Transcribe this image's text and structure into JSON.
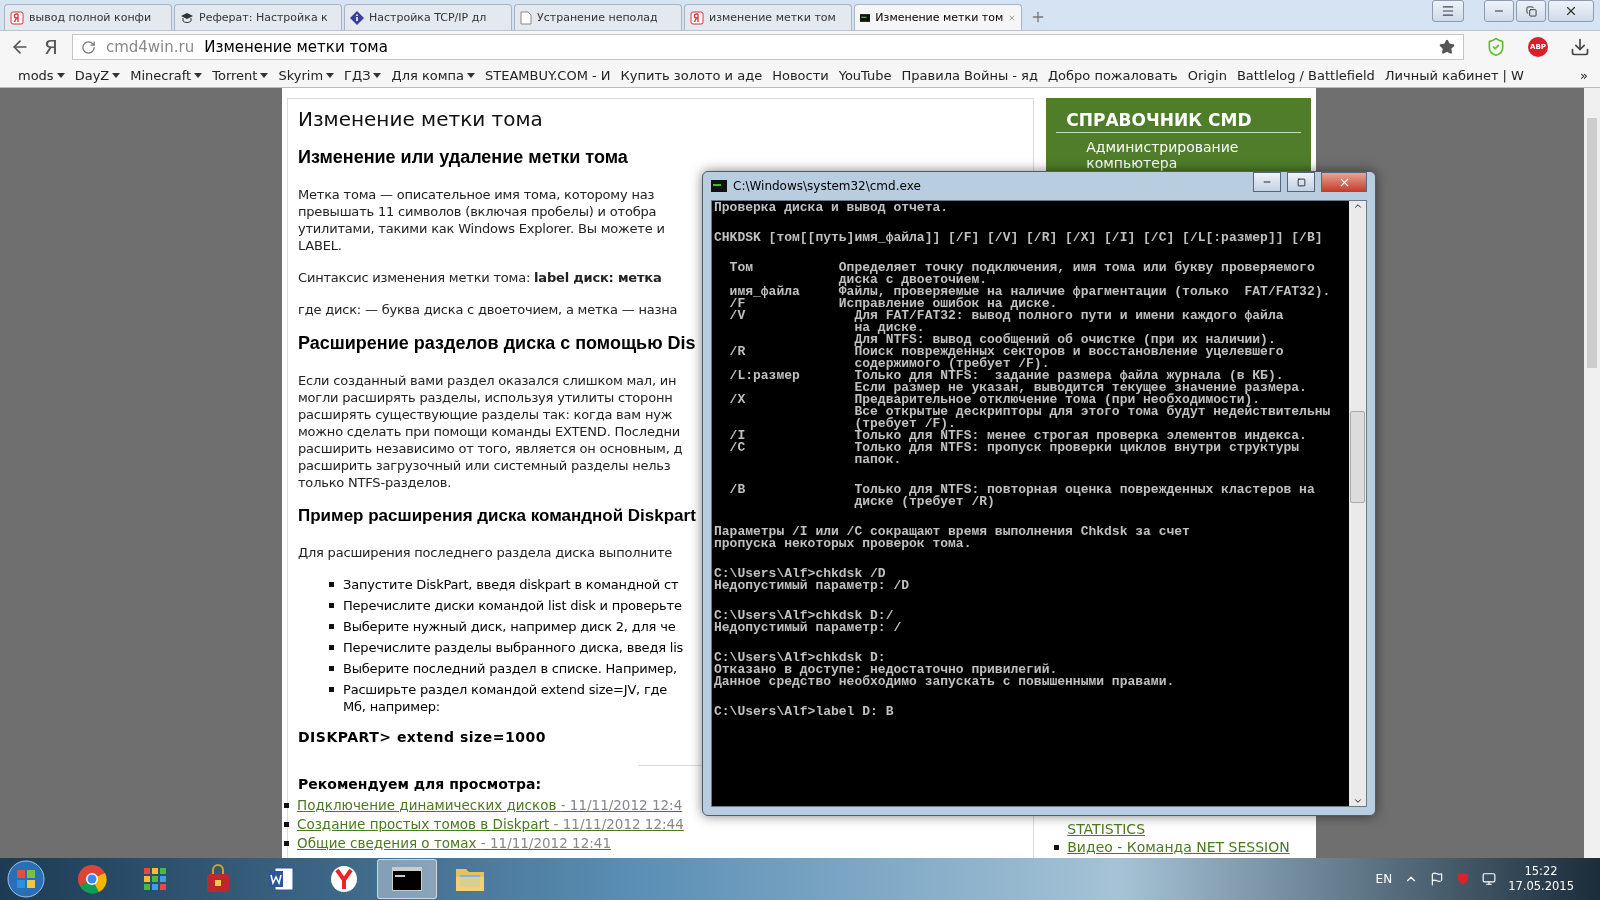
{
  "browser": {
    "tabs": [
      {
        "label": "вывод полной конфи",
        "selected": false
      },
      {
        "label": "Реферат: Настройка к",
        "selected": false
      },
      {
        "label": "Настройка TCP/IP дл",
        "selected": false
      },
      {
        "label": "Устранение неполад",
        "selected": false
      },
      {
        "label": "изменение метки том",
        "selected": false
      },
      {
        "label": "Изменение метки том",
        "selected": true
      }
    ],
    "yandex_button": "Я",
    "address": {
      "domain": "cmd4win.ru",
      "title": "Изменение метки тома"
    },
    "abp_badge": "ABP",
    "bookmarks": [
      {
        "label": "mods",
        "kind": "folder"
      },
      {
        "label": "DayZ",
        "kind": "folder"
      },
      {
        "label": "Minecraft",
        "kind": "folder"
      },
      {
        "label": "Torrent",
        "kind": "folder"
      },
      {
        "label": "Skyrim",
        "kind": "folder"
      },
      {
        "label": "ГДЗ",
        "kind": "folder"
      },
      {
        "label": "Для компа",
        "kind": "folder"
      },
      {
        "label": "STEAMBUY.COM - И",
        "kind": "link"
      },
      {
        "label": "Купить золото и аде",
        "kind": "link"
      },
      {
        "label": "Новости",
        "kind": "link"
      },
      {
        "label": "YouTube",
        "kind": "link"
      },
      {
        "label": "Правила Войны - яд",
        "kind": "link"
      },
      {
        "label": "Добро пожаловать",
        "kind": "link"
      },
      {
        "label": "Origin",
        "kind": "link"
      },
      {
        "label": "Battlelog / Battlefield",
        "kind": "link"
      },
      {
        "label": "Личный кабинет | W",
        "kind": "link"
      }
    ],
    "bookmarks_more": "»"
  },
  "article": {
    "title": "Изменение метки тома",
    "sections": [
      {
        "kind": "h2",
        "text": "Изменение или удаление метки тома"
      },
      {
        "kind": "para",
        "lines": [
          "Метка тома — описательное имя тома, которому наз",
          "превышать 11 символов (включая пробелы) и отобра",
          "утилитами, такими как Windows Explorer. Вы можете и",
          "LABEL."
        ]
      },
      {
        "kind": "para",
        "lines": [
          "Синтаксис изменения метки тома: **label диск: метка**"
        ]
      },
      {
        "kind": "para",
        "lines": [
          "где диск: — буква диска с двоеточием, а метка — назна"
        ]
      },
      {
        "kind": "h2",
        "text": "Расширение разделов диска с помощью Dis"
      },
      {
        "kind": "para",
        "lines": [
          "Если созданный вами раздел оказался слишком мал, ин",
          "могли расширять разделы, используя утилиты сторонн",
          "расширять существующие разделы так: когда вам нуж",
          "можно сделать при помощи команды EXTEND. Последни",
          "расширить независимо от того, является он основным, д",
          "расширить загрузочный или системный разделы нельз",
          "только NTFS-разделов."
        ]
      },
      {
        "kind": "h3",
        "text": "Пример расширения диска командной Diskpart"
      },
      {
        "kind": "para",
        "lines": [
          "Для расширения последнего раздела диска выполните"
        ]
      },
      {
        "kind": "list",
        "items": [
          [
            "Запустите DiskPart, введя diskpart в командной ст"
          ],
          [
            "Перечислите диски командой list disk и проверьте"
          ],
          [
            "Выберите нужный диск, например диск 2, для че"
          ],
          [
            "Перечислите разделы выбранного диска, введя lis"
          ],
          [
            "Выберите последний раздел в списке. Например,"
          ],
          [
            "Расширьте раздел командой extend size=JV, где",
            "Мб, например:"
          ]
        ]
      },
      {
        "kind": "code",
        "text": "DISKPART> extend size=1000"
      },
      {
        "kind": "divider"
      }
    ],
    "recommend_title": "Рекомендуем для просмотра:",
    "recommend": [
      {
        "title": "Подключение динамических дисков",
        "date": "- 11/11/2012 12:4"
      },
      {
        "title": "Создание простых томов в Diskpart",
        "date": "- 11/11/2012 12:44"
      },
      {
        "title": "Общие сведения о томах",
        "date": "- 11/11/2012 12:41"
      }
    ]
  },
  "sidebar": {
    "title": "СПРАВОЧНИК CMD",
    "menu": [
      "Администрирование компьютера"
    ],
    "links": [
      {
        "text": "STATISTICS",
        "kind": "continuation"
      },
      {
        "text": "Видео - Команда NET SESSION",
        "kind": "item"
      }
    ]
  },
  "console": {
    "title": "C:\\Windows\\system32\\cmd.exe",
    "blocks": [
      {
        "lines": [
          "Проверка диска и вывод отчета."
        ]
      },
      {
        "lines": [
          "CHKDSK [том[[путь]имя_файла]] [/F] [/V] [/R] [/X] [/I] [/C] [/L[:размер]] [/B]"
        ]
      },
      {
        "lines": [
          "  Том           Определяет точку подключения, имя тома или букву проверяемого",
          "                диска с двоеточием.",
          "  имя_файла     Файлы, проверяемые на наличие фрагментации (только  FAT/FAT32).",
          "  /F            Исправление ошибок на диске.",
          "  /V              Для FAT/FAT32: вывод полного пути и имени каждого файла",
          "                  на диске.",
          "                  Для NTFS: вывод сообщений об очистке (при их наличии).",
          "  /R              Поиск поврежденных секторов и восстановление уцелевшего",
          "                  содержимого (требует /F).",
          "  /L:размер       Только для NTFS:  задание размера файла журнала (в КБ).",
          "                  Если размер не указан, выводится текущее значение размера.",
          "  /X              Предварительное отключение тома (при необходимости).",
          "                  Все открытые дескрипторы для этого тома будут недействительны",
          "                  (требует /F).",
          "  /I              Только для NTFS: менее строгая проверка элементов индекса.",
          "  /C              Только для NTFS: пропуск проверки циклов внутри структуры",
          "                  папок."
        ]
      },
      {
        "lines": [
          "  /B              Только для NTFS: повторная оценка поврежденных кластеров на",
          "                  диске (требует /R)"
        ]
      },
      {
        "lines": [
          "Параметры /I или /C сокращают время выполнения Chkdsk за счет",
          "пропуска некоторых проверок тома."
        ]
      },
      {
        "lines": [
          "C:\\Users\\Alf>chkdsk /D",
          "Недопустимый параметр: /D"
        ]
      },
      {
        "lines": [
          "C:\\Users\\Alf>chkdsk D:/",
          "Недопустимый параметр: /"
        ]
      },
      {
        "lines": [
          "C:\\Users\\Alf>chkdsk D:",
          "Отказано в доступе: недостаточно привилегий.",
          "Данное средство необходимо запускать с повышенными правами."
        ]
      },
      {
        "lines": [
          "C:\\Users\\Alf>label D: B"
        ]
      }
    ]
  },
  "taskbar": {
    "apps": [
      {
        "kind": "chrome",
        "selected": false
      },
      {
        "kind": "grid",
        "selected": false
      },
      {
        "kind": "bag",
        "selected": false
      },
      {
        "kind": "word",
        "selected": false
      },
      {
        "kind": "yandex",
        "selected": false
      },
      {
        "kind": "console",
        "selected": true
      },
      {
        "kind": "folder",
        "selected": false
      }
    ],
    "language": "EN",
    "time": "15:22",
    "date": "17.05.2015"
  }
}
